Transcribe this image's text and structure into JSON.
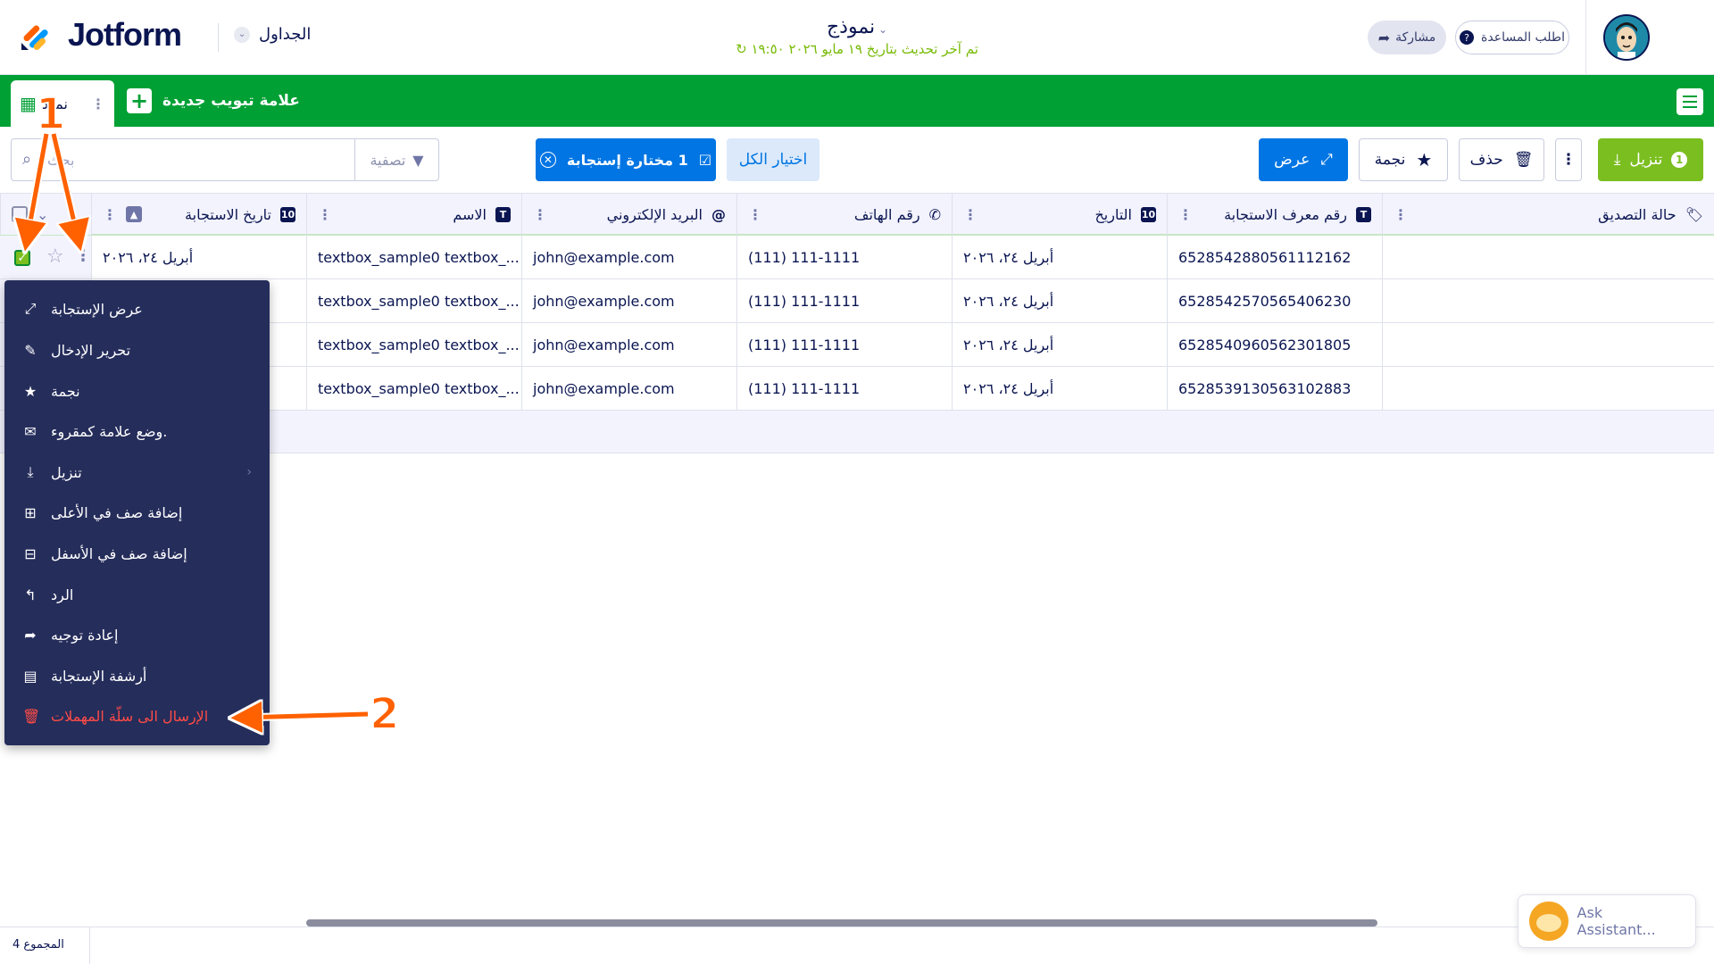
{
  "header": {
    "logo_text": "Jotform",
    "tables_label": "الجداول",
    "form_title": "نموذج",
    "last_updated": "تم آخر تحديث بتاريخ ١٩ مايو ٢٠٢٦ ١٩:٥٠",
    "help_label": "اطلب المساعدة",
    "share_label": "مشاركة"
  },
  "tabs": {
    "active_label": "نموذ",
    "new_tab_label": "علامة تبويب جديدة"
  },
  "toolbar": {
    "search_placeholder": "بحث",
    "filter_label": "تصفية",
    "selected_label": "1 مختارة إستجابة",
    "select_all_label": "اختيار الكل",
    "view_label": "عرض",
    "star_label": "نجمة",
    "delete_label": "حذف",
    "download_label": "تنزيل",
    "download_badge": "1"
  },
  "table": {
    "columns": [
      {
        "label": "تاريخ الاستجابة",
        "icon": "calendar-icon"
      },
      {
        "label": "الاسم",
        "icon": "text-icon"
      },
      {
        "label": "البريد الإلكتروني",
        "icon": "at-icon"
      },
      {
        "label": "رقم الهاتف",
        "icon": "phone-icon"
      },
      {
        "label": "التاريخ",
        "icon": "calendar-icon"
      },
      {
        "label": "رقم معرف الاستجابة",
        "icon": "text-icon"
      },
      {
        "label": "حالة التصديق",
        "icon": "tag-icon"
      }
    ],
    "rows": [
      {
        "date": "أبريل ٢٤، ٢٠٢٦",
        "name": "textbox_sample0 textbox_...",
        "email": "john@example.com",
        "phone": "(111) 111-1111",
        "field_date": "أبريل ٢٤، ٢٠٢٦",
        "id": "6528542880561112162",
        "status": ""
      },
      {
        "date": "",
        "name": "textbox_sample0 textbox_...",
        "email": "john@example.com",
        "phone": "(111) 111-1111",
        "field_date": "أبريل ٢٤، ٢٠٢٦",
        "id": "6528542570565406230",
        "status": ""
      },
      {
        "date": "",
        "name": "textbox_sample0 textbox_...",
        "email": "john@example.com",
        "phone": "(111) 111-1111",
        "field_date": "أبريل ٢٤، ٢٠٢٦",
        "id": "6528540960562301805",
        "status": ""
      },
      {
        "date": "",
        "name": "textbox_sample0 textbox_...",
        "email": "john@example.com",
        "phone": "(111) 111-1111",
        "field_date": "أبريل ٢٤، ٢٠٢٦",
        "id": "6528539130563102883",
        "status": ""
      }
    ]
  },
  "context_menu": {
    "items": [
      {
        "label": "عرض الإستجابة",
        "icon": "expand-icon"
      },
      {
        "label": "تحرير الإدخال",
        "icon": "edit-icon"
      },
      {
        "label": "نجمة",
        "icon": "star-icon"
      },
      {
        "label": "وضع علامة كمقروء.",
        "icon": "envelope-open-icon"
      },
      {
        "label": "تنزيل",
        "icon": "download-icon"
      },
      {
        "label": "إضافة صف في الأعلى",
        "icon": "row-above-icon"
      },
      {
        "label": "إضافة صف في الأسفل",
        "icon": "row-below-icon"
      },
      {
        "label": "الرد",
        "icon": "reply-icon"
      },
      {
        "label": "إعادة توجيه",
        "icon": "forward-icon"
      },
      {
        "label": "أرشفة الإستجابة",
        "icon": "archive-icon"
      },
      {
        "label": "الإرسال الى سلّة المهملات",
        "icon": "trash-icon"
      }
    ]
  },
  "footer": {
    "total_label": "المجموع 4",
    "assistant_label": "Ask Assistant..."
  },
  "annotations": {
    "one": "1",
    "two": "2"
  },
  "colors": {
    "brand_green": "#01a035",
    "primary_blue": "#0075e3",
    "menu_bg": "#252d5b",
    "danger": "#ff4b45",
    "annotation": "#ff6100"
  }
}
